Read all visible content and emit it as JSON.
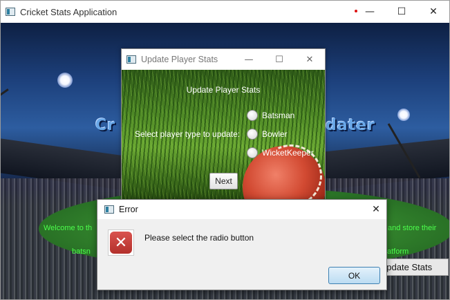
{
  "main_window": {
    "title": "Cricket Stats Application",
    "controls": {
      "minimize": "—",
      "maximize": "☐",
      "close": "✕"
    }
  },
  "background": {
    "heading_left": "Cr",
    "heading_right": "dater",
    "welcome_text_left": "Welcome to th",
    "welcome_text_right": "and store their",
    "platform_text_left": "batsn",
    "platform_text_right": "atform"
  },
  "update_stats_button": "Update Stats",
  "update_dialog": {
    "title": "Update Player Stats",
    "heading": "Update Player Stats",
    "prompt": "Select player type to update:",
    "options": [
      "Batsman",
      "Bowler",
      "WicketKeeper"
    ],
    "next_label": "Next",
    "controls": {
      "minimize": "—",
      "maximize": "☐",
      "close": "✕"
    }
  },
  "error_dialog": {
    "title": "Error",
    "message": "Please select the radio button",
    "ok_label": "OK",
    "close": "✕",
    "icon_glyph": "✕"
  },
  "icons": {
    "window_icon": "app-window-icon",
    "error_icon": "error-x-icon"
  }
}
